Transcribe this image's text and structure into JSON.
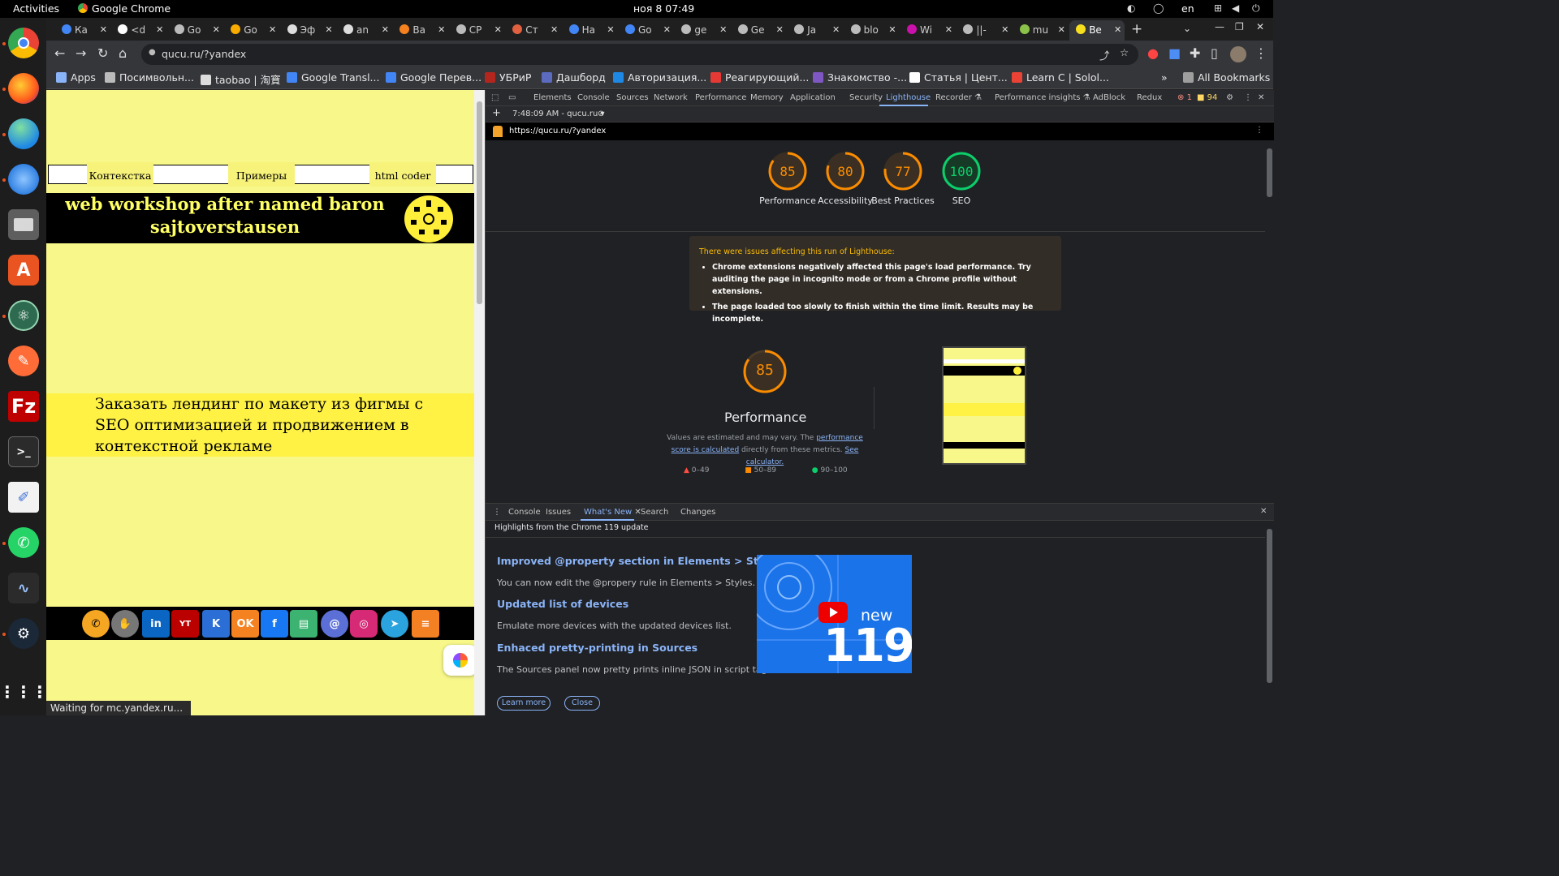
{
  "topbar": {
    "activities": "Activities",
    "app_name": "Google Chrome",
    "clock": "ноя 8  07:49",
    "lang": "en"
  },
  "tabs": [
    {
      "label": "Ка"
    },
    {
      "label": "<d"
    },
    {
      "label": "Go"
    },
    {
      "label": "Go"
    },
    {
      "label": "Эф"
    },
    {
      "label": "an"
    },
    {
      "label": "Ва"
    },
    {
      "label": "CP"
    },
    {
      "label": "Ст"
    },
    {
      "label": "На"
    },
    {
      "label": "Go"
    },
    {
      "label": "ge"
    },
    {
      "label": "Ge"
    },
    {
      "label": "Ja"
    },
    {
      "label": "blo"
    },
    {
      "label": "Wi"
    },
    {
      "label": "||-"
    },
    {
      "label": "mu"
    },
    {
      "label": "Be"
    }
  ],
  "omnibox": {
    "url": "qucu.ru/?yandex"
  },
  "bookmarks": [
    {
      "label": "Apps",
      "color": "#8ab4f8"
    },
    {
      "label": "Посимвольн...",
      "color": "#bbbbbb"
    },
    {
      "label": "taobao | 淘寶",
      "color": "#dddddd"
    },
    {
      "label": "Google Transl...",
      "color": "#4285f4"
    },
    {
      "label": "Google Перев...",
      "color": "#4285f4"
    },
    {
      "label": "УБРиР",
      "color": "#b3261e"
    },
    {
      "label": "Дашборд",
      "color": "#5c6bc0"
    },
    {
      "label": "Авторизация...",
      "color": "#1e88e5"
    },
    {
      "label": "Реагирующий...",
      "color": "#e53935"
    },
    {
      "label": "Знакомство -...",
      "color": "#7e57c2"
    },
    {
      "label": "Статья  |  Цент...",
      "color": "#ffffff"
    },
    {
      "label": "Learn C | Solol...",
      "color": "#ea4335"
    }
  ],
  "all_bookmarks": "All Bookmarks",
  "page": {
    "nav": [
      "Контекстка",
      "Примеры",
      "html coder"
    ],
    "hero_title": "web workshop after named baron sajtoverstausen",
    "promo_text": "Заказать лендинг по макету из фигмы с SEO оптимизацией и продвижением в контекстной рекламе",
    "status": "Waiting for mc.yandex.ru..."
  },
  "devtools": {
    "tabs": [
      "Elements",
      "Console",
      "Sources",
      "Network",
      "Performance",
      "Memory",
      "Application",
      "Security",
      "Lighthouse",
      "Recorder ⚗",
      "Performance insights ⚗",
      "AdBlock",
      "Redux"
    ],
    "errors": "1",
    "warnings": "94",
    "report_time": "7:48:09 AM - qucu.ru",
    "report_url": "https://qucu.ru/?yandex",
    "scores": [
      {
        "label": "Performance",
        "value": "85",
        "color": "#fb8c00"
      },
      {
        "label": "Accessibility",
        "value": "80",
        "color": "#fb8c00"
      },
      {
        "label": "Best Practices",
        "value": "77",
        "color": "#fb8c00"
      },
      {
        "label": "SEO",
        "value": "100",
        "color": "#0cce6b"
      }
    ],
    "warning_head": "There were issues affecting this run of Lighthouse:",
    "warning_items": [
      "Chrome extensions negatively affected this page's load performance. Try auditing the page in incognito mode or from a Chrome profile without extensions.",
      "The page loaded too slowly to finish within the time limit. Results may be incomplete."
    ],
    "perf_score": "85",
    "perf_label": "Performance",
    "perf_note_a": "Values are estimated and may vary. The",
    "perf_note_link": "performance score is calculated",
    "perf_note_b": "directly from these metrics.",
    "perf_note_link2": "See calculator.",
    "legend": [
      "0–49",
      "50–89",
      "90–100"
    ],
    "drawer_tabs": [
      "Console",
      "Issues",
      "What's New",
      "Search",
      "Changes"
    ],
    "whatsnew_heading": "Highlights from the Chrome 119 update",
    "whatsnew": [
      {
        "title": "Improved @property section in Elements > Styles",
        "text": "You can now edit the @propery rule in Elements > Styles."
      },
      {
        "title": "Updated list of devices",
        "text": "Emulate more devices with the updated devices list."
      },
      {
        "title": "Enhaced pretty-printing in Sources",
        "text": "The Sources panel now pretty prints inline JSON in script tags."
      }
    ],
    "promo_new": "new",
    "promo_version": "119",
    "learn_more": "Learn more",
    "close": "Close"
  }
}
